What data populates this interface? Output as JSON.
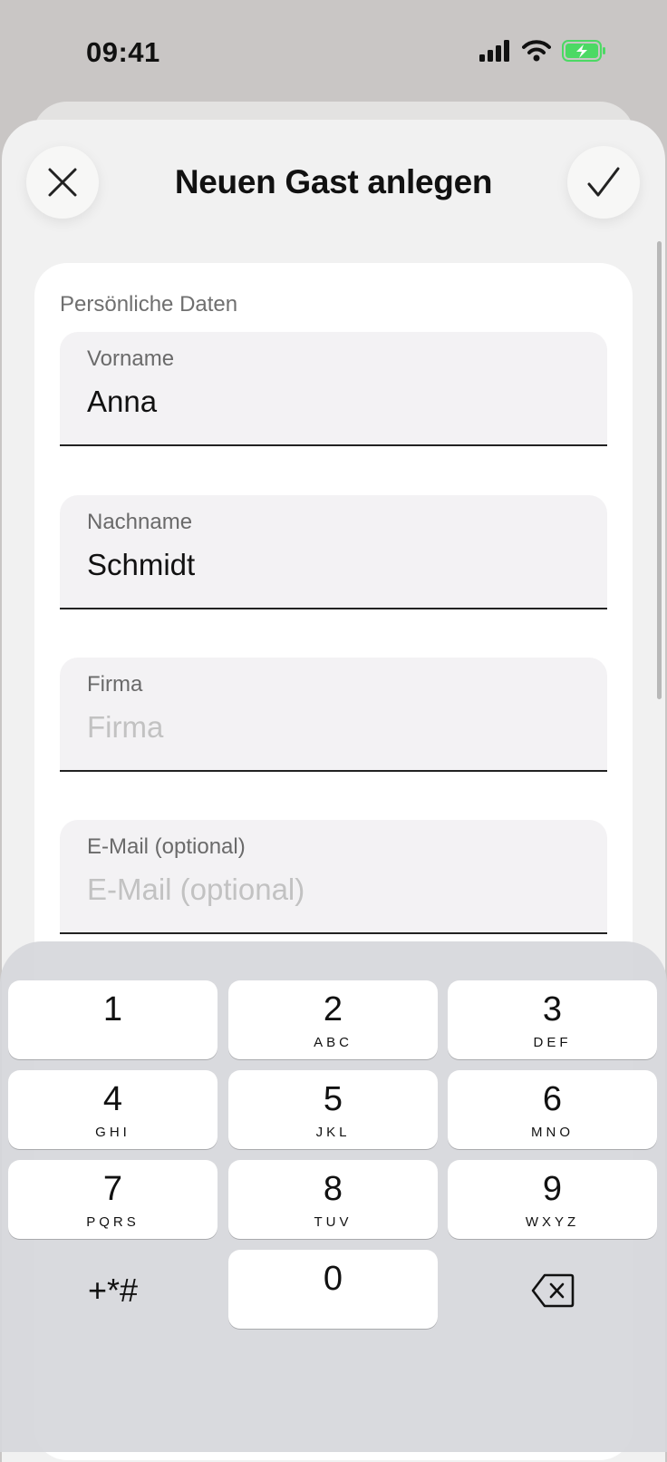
{
  "status_bar": {
    "time": "09:41",
    "icons": [
      "cellular-signal-icon",
      "wifi-icon",
      "battery-charging-icon"
    ],
    "battery_color": "#4cd964"
  },
  "header": {
    "title": "Neuen Gast anlegen",
    "close_icon": "close-icon",
    "confirm_icon": "checkmark-icon"
  },
  "form": {
    "section_title": "Persönliche Daten",
    "fields": [
      {
        "label": "Vorname",
        "value": "Anna",
        "placeholder": ""
      },
      {
        "label": "Nachname",
        "value": "Schmidt",
        "placeholder": ""
      },
      {
        "label": "Firma",
        "value": "",
        "placeholder": "Firma"
      },
      {
        "label": "E-Mail (optional)",
        "value": "",
        "placeholder": "E-Mail (optional)"
      }
    ]
  },
  "keypad": {
    "keys": [
      {
        "digit": "1",
        "letters": ""
      },
      {
        "digit": "2",
        "letters": "ABC"
      },
      {
        "digit": "3",
        "letters": "DEF"
      },
      {
        "digit": "4",
        "letters": "GHI"
      },
      {
        "digit": "5",
        "letters": "JKL"
      },
      {
        "digit": "6",
        "letters": "MNO"
      },
      {
        "digit": "7",
        "letters": "PQRS"
      },
      {
        "digit": "8",
        "letters": "TUV"
      },
      {
        "digit": "9",
        "letters": "WXYZ"
      },
      {
        "digit": "0",
        "letters": ""
      }
    ],
    "symbols": "+*#",
    "delete_icon": "delete-backspace-icon"
  }
}
